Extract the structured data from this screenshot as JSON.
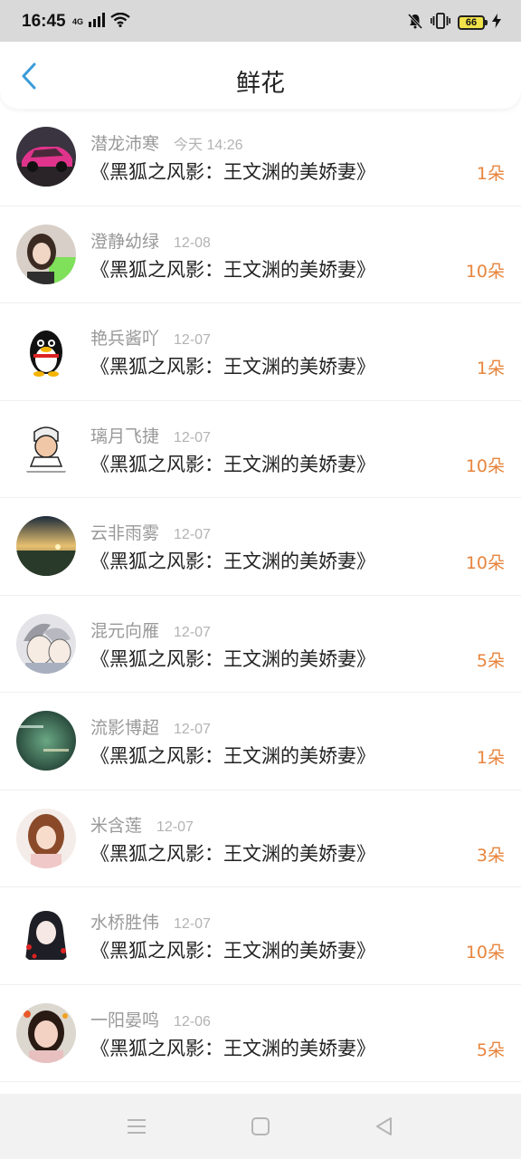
{
  "status_bar": {
    "time": "16:45",
    "network_type": "4G",
    "battery_level": "66",
    "icons": [
      "signal-icon",
      "wifi-icon",
      "mute-icon",
      "vibrate-icon",
      "battery-icon",
      "charging-icon"
    ]
  },
  "header": {
    "title": "鲜花",
    "back_icon": "chevron-left-icon",
    "accent_color": "#3a9bd9"
  },
  "colors": {
    "count_color": "#e8843c",
    "name_color": "#999999",
    "title_color": "#222222"
  },
  "items": [
    {
      "name": "潜龙沛寒",
      "time": "今天 14:26",
      "title": "《黑狐之风影：王文渊的美娇妻》",
      "count": "1朵",
      "avatar": "pink-car-avatar"
    },
    {
      "name": "澄静幼绿",
      "time": "12-08",
      "title": "《黑狐之风影：王文渊的美娇妻》",
      "count": "10朵",
      "avatar": "girl-avatar"
    },
    {
      "name": "艳兵酱吖",
      "time": "12-07",
      "title": "《黑狐之风影：王文渊的美娇妻》",
      "count": "1朵",
      "avatar": "penguin-avatar"
    },
    {
      "name": "璃月飞捷",
      "time": "12-07",
      "title": "《黑狐之风影：王文渊的美娇妻》",
      "count": "10朵",
      "avatar": "cartoon-avatar"
    },
    {
      "name": "云非雨雾",
      "time": "12-07",
      "title": "《黑狐之风影：王文渊的美娇妻》",
      "count": "10朵",
      "avatar": "landscape-avatar"
    },
    {
      "name": "混元向雁",
      "time": "12-07",
      "title": "《黑狐之风影：王文渊的美娇妻》",
      "count": "5朵",
      "avatar": "anime-avatar"
    },
    {
      "name": "流影博超",
      "time": "12-07",
      "title": "《黑狐之风影：王文渊的美娇妻》",
      "count": "1朵",
      "avatar": "text-avatar"
    },
    {
      "name": "米含莲",
      "time": "12-07",
      "title": "《黑狐之风影：王文渊的美娇妻》",
      "count": "3朵",
      "avatar": "girl-photo-avatar"
    },
    {
      "name": "水桥胜伟",
      "time": "12-07",
      "title": "《黑狐之风影：王文渊的美娇妻》",
      "count": "10朵",
      "avatar": "anime-girl-avatar"
    },
    {
      "name": "一阳晏鸣",
      "time": "12-06",
      "title": "《黑狐之风影：王文渊的美娇妻》",
      "count": "5朵",
      "avatar": "woman-photo-avatar"
    }
  ],
  "nav_bar": {
    "icons": [
      "menu-icon",
      "home-icon",
      "back-icon"
    ]
  }
}
